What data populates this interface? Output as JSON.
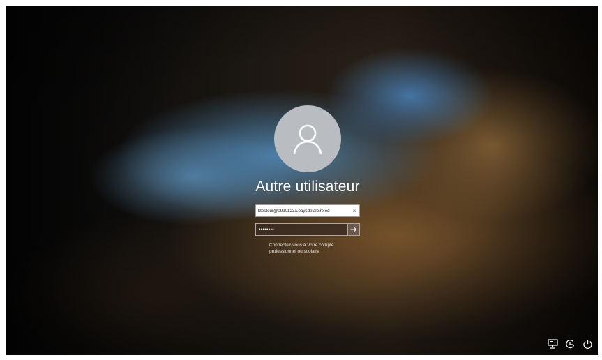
{
  "login": {
    "username": "Autre utilisateur",
    "email_value": "ktesteur@0990123a.paysdelaloire.ed",
    "clear_symbol": "×",
    "password_masked": "••••••••",
    "hint_line1": "Connectez-vous à Votre compte",
    "hint_line2": "professionnel ou scolaire"
  },
  "icons": {
    "avatar": "user-silhouette-icon",
    "submit": "arrow-right-icon",
    "network": "network-icon",
    "accessibility": "ease-of-access-icon",
    "power": "power-icon"
  },
  "colors": {
    "avatar_bg": "#b9bdc2",
    "text": "#ffffff"
  }
}
